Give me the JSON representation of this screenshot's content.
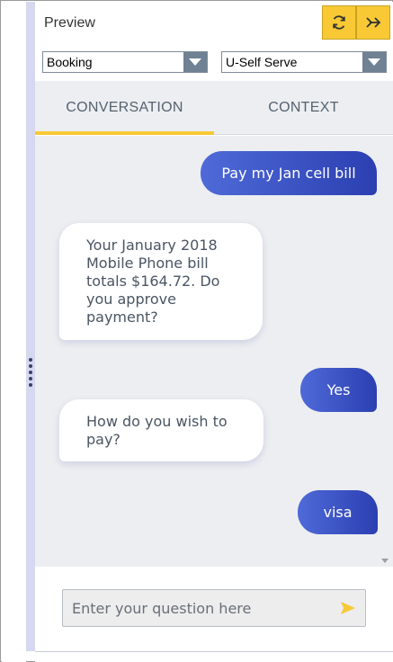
{
  "header": {
    "title": "Preview",
    "refresh_icon": "refresh-icon",
    "expand_icon": "arrow-right-icon"
  },
  "selects": {
    "left_value": "Booking",
    "right_value": "U-Self Serve"
  },
  "tabs": [
    {
      "label": "CONVERSATION",
      "active": true
    },
    {
      "label": "CONTEXT",
      "active": false
    }
  ],
  "messages": [
    {
      "from": "user",
      "text": "Pay my Jan cell bill"
    },
    {
      "from": "bot",
      "text": "Your January 2018 Mobile Phone bill totals $164.72.  Do you approve payment?"
    },
    {
      "from": "user",
      "text": "Yes"
    },
    {
      "from": "bot",
      "text": "How do you wish to pay?"
    },
    {
      "from": "user",
      "text": "visa"
    }
  ],
  "input": {
    "placeholder": "Enter your question here",
    "value": ""
  },
  "colors": {
    "accent": "#f8c934",
    "user_bubble": "#3a52c8",
    "tab_text": "#556270",
    "chat_background": "#eceef1"
  }
}
